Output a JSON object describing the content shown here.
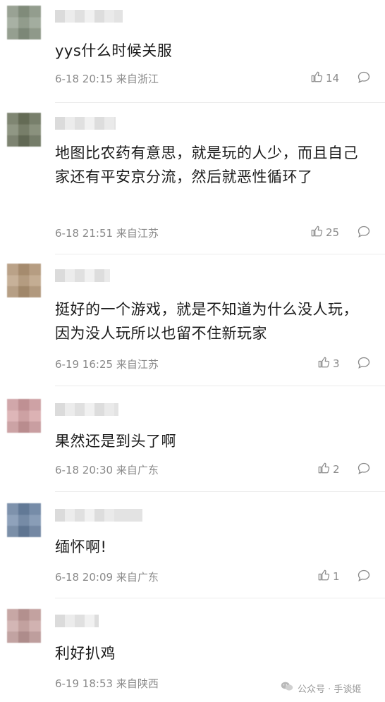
{
  "comments": [
    {
      "text": "yys什么时候关服",
      "date": "6-18 20:15",
      "location": "来自浙江",
      "likes": "14",
      "avatar_color": "#8e9a88"
    },
    {
      "text": "地图比农药有意思，就是玩的人少，而且自己家还有平安京分流，然后就恶性循环了",
      "date": "6-18 21:51",
      "location": "来自江苏",
      "likes": "25",
      "avatar_color": "#6f775f"
    },
    {
      "text": "挺好的一个游戏，就是不知道为什么没人玩，因为没人玩所以也留不住新玩家",
      "date": "6-19 16:25",
      "location": "来自江苏",
      "likes": "3",
      "avatar_color": "#b79a7a"
    },
    {
      "text": "果然还是到头了啊",
      "date": "6-18 20:30",
      "location": "来自广东",
      "likes": "2",
      "avatar_color": "#d4a0a3"
    },
    {
      "text": "缅怀啊!",
      "date": "6-18 20:09",
      "location": "来自广东",
      "likes": "1",
      "avatar_color": "#6d86a6"
    },
    {
      "text": "利好扒鸡",
      "date": "6-19 18:53",
      "location": "来自陕西",
      "likes": "",
      "avatar_color": "#c7a09e"
    }
  ],
  "watermark": {
    "text": "公众号 · 手谈姬"
  },
  "icons": {
    "like": "thumbs-up-icon",
    "reply": "comment-bubble-icon",
    "watermark": "wechat-icon"
  }
}
